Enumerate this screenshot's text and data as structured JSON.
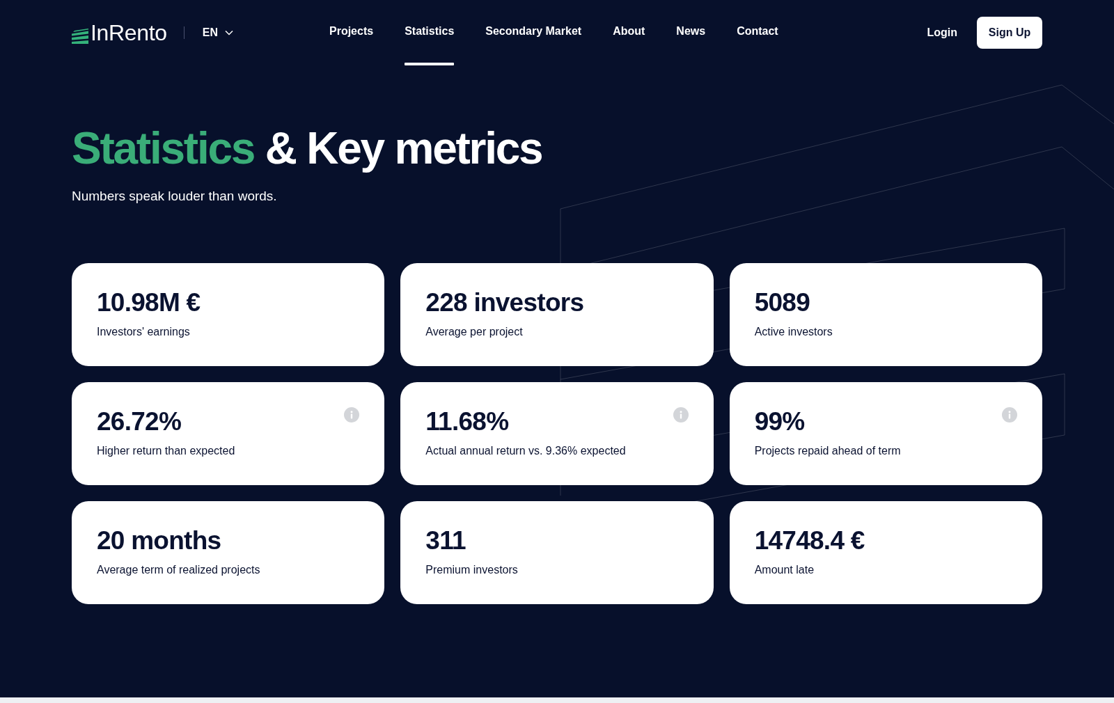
{
  "header": {
    "logo": "InRento",
    "language": "EN",
    "nav": [
      {
        "label": "Projects",
        "selected": false
      },
      {
        "label": "Statistics",
        "selected": true
      },
      {
        "label": "Secondary Market",
        "selected": false
      },
      {
        "label": "About",
        "selected": false
      },
      {
        "label": "News",
        "selected": false
      },
      {
        "label": "Contact",
        "selected": false
      }
    ],
    "login": "Login",
    "sign_up": "Sign Up"
  },
  "hero": {
    "title_highlight": "Statistics",
    "title": "& Key metrics",
    "subtitle": "Numbers speak louder than words."
  },
  "metrics": [
    {
      "value": "10.98M €",
      "label": "Investors' earnings",
      "has_info": false
    },
    {
      "value": "228 investors",
      "label": "Average per project",
      "has_info": false
    },
    {
      "value": "5089",
      "label": "Active investors",
      "has_info": false
    },
    {
      "value": "26.72%",
      "label": "Higher return than expected",
      "has_info": true
    },
    {
      "value": "11.68%",
      "label": "Actual annual return vs. 9.36% expected",
      "has_info": true
    },
    {
      "value": "99%",
      "label": "Projects repaid ahead of term",
      "has_info": true
    },
    {
      "value": "20 months",
      "label": "Average term of realized projects",
      "has_info": false
    },
    {
      "value": "311",
      "label": "Premium investors",
      "has_info": false
    },
    {
      "value": "14748.4 €",
      "label": "Amount late",
      "has_info": false
    }
  ]
}
